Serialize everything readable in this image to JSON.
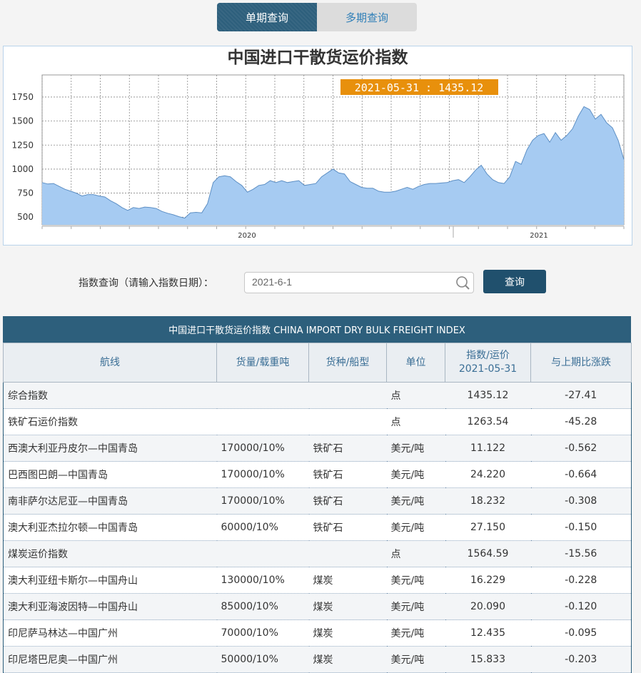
{
  "tabs": [
    {
      "label": "单期查询",
      "active": true
    },
    {
      "label": "多期查询",
      "active": false
    }
  ],
  "chart_data": {
    "type": "area",
    "title": "中国进口干散货运价指数",
    "tooltip": "2021-05-31 : 1435.12",
    "ylim": [
      420,
      1980
    ],
    "yticks": [
      500,
      750,
      1000,
      1250,
      1500,
      1750
    ],
    "xtick_labels": [
      "2020",
      "2021"
    ],
    "grid": true,
    "fill_color": "#a6cbf2",
    "line_color": "#5d8fc4",
    "tooltip_bg": "#e8900c",
    "series": [
      {
        "values": [
          860,
          845,
          850,
          820,
          790,
          770,
          750,
          720,
          735,
          735,
          720,
          710,
          670,
          640,
          600,
          570,
          600,
          590,
          605,
          600,
          590,
          560,
          540,
          525,
          505,
          490,
          545,
          550,
          545,
          640,
          860,
          920,
          930,
          920,
          870,
          830,
          760,
          790,
          830,
          840,
          880,
          860,
          880,
          860,
          870,
          880,
          830,
          840,
          850,
          920,
          960,
          1000,
          960,
          950,
          870,
          840,
          810,
          800,
          800,
          770,
          760,
          760,
          770,
          790,
          810,
          790,
          820,
          840,
          850,
          850,
          855,
          860,
          880,
          890,
          860,
          920,
          990,
          1040,
          950,
          890,
          860,
          850,
          920,
          1080,
          1050,
          1200,
          1300,
          1350,
          1370,
          1280,
          1380,
          1300,
          1350,
          1420,
          1550,
          1650,
          1620,
          1520,
          1570,
          1480,
          1430,
          1300,
          1100
        ]
      }
    ]
  },
  "query": {
    "label": "指数查询（请输入指数日期）：",
    "value": "2021-6-1",
    "button": "查询"
  },
  "table": {
    "title": "中国进口干散货运价指数 CHINA IMPORT DRY BULK FREIGHT INDEX",
    "headers": [
      "航线",
      "货量/载重吨",
      "货种/船型",
      "单位",
      "指数/运价\n2021-05-31",
      "与上期比涨跌"
    ],
    "rows": [
      {
        "route": "综合指数",
        "cargo": "",
        "type": "",
        "unit": "点",
        "value": "1435.12",
        "change": "-27.41"
      },
      {
        "route": "铁矿石运价指数",
        "cargo": "",
        "type": "",
        "unit": "点",
        "value": "1263.54",
        "change": "-45.28"
      },
      {
        "route": "西澳大利亚丹皮尔—中国青岛",
        "cargo": "170000/10%",
        "type": "铁矿石",
        "unit": "美元/吨",
        "value": "11.122",
        "change": "-0.562"
      },
      {
        "route": "巴西图巴朗—中国青岛",
        "cargo": "170000/10%",
        "type": "铁矿石",
        "unit": "美元/吨",
        "value": "24.220",
        "change": "-0.664"
      },
      {
        "route": "南非萨尔达尼亚—中国青岛",
        "cargo": "170000/10%",
        "type": "铁矿石",
        "unit": "美元/吨",
        "value": "18.232",
        "change": "-0.308"
      },
      {
        "route": "澳大利亚杰拉尔顿—中国青岛",
        "cargo": "60000/10%",
        "type": "铁矿石",
        "unit": "美元/吨",
        "value": "27.150",
        "change": "-0.150"
      },
      {
        "route": "煤炭运价指数",
        "cargo": "",
        "type": "",
        "unit": "点",
        "value": "1564.59",
        "change": "-15.56"
      },
      {
        "route": "澳大利亚纽卡斯尔—中国舟山",
        "cargo": "130000/10%",
        "type": "煤炭",
        "unit": "美元/吨",
        "value": "16.229",
        "change": "-0.228"
      },
      {
        "route": "澳大利亚海波因特—中国舟山",
        "cargo": "85000/10%",
        "type": "煤炭",
        "unit": "美元/吨",
        "value": "20.090",
        "change": "-0.120"
      },
      {
        "route": "印尼萨马林达—中国广州",
        "cargo": "70000/10%",
        "type": "煤炭",
        "unit": "美元/吨",
        "value": "12.435",
        "change": "-0.095"
      },
      {
        "route": "印尼塔巴尼奥—中国广州",
        "cargo": "50000/10%",
        "type": "煤炭",
        "unit": "美元/吨",
        "value": "15.833",
        "change": "-0.203"
      }
    ]
  }
}
